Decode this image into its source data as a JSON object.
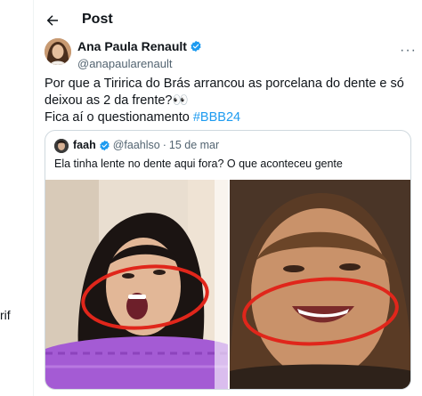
{
  "sidebar": {
    "partial_text": "rif"
  },
  "header": {
    "title": "Post"
  },
  "tweet": {
    "author_name": "Ana Paula Renault",
    "author_handle": "@anapaularenault",
    "line1": "Por que a Tiririca do Brás arrancou as porcelana do dente e só deixou as 2 da frente?👀",
    "line2": "Fica aí o questionamento ",
    "hashtag": "#BBB24"
  },
  "quote": {
    "author_name": "faah",
    "author_handle": "@faahlso",
    "separator": "·",
    "date": "15 de mar",
    "text": "Ela tinha lente no dente aqui fora? O que aconteceu gente"
  },
  "colors": {
    "accent": "#1d9bf0",
    "annotation": "#e0261b",
    "muted": "#536471"
  },
  "icons": {
    "back": "arrow-left-icon",
    "verified": "verified-badge-icon",
    "more": "more-dots-icon"
  }
}
